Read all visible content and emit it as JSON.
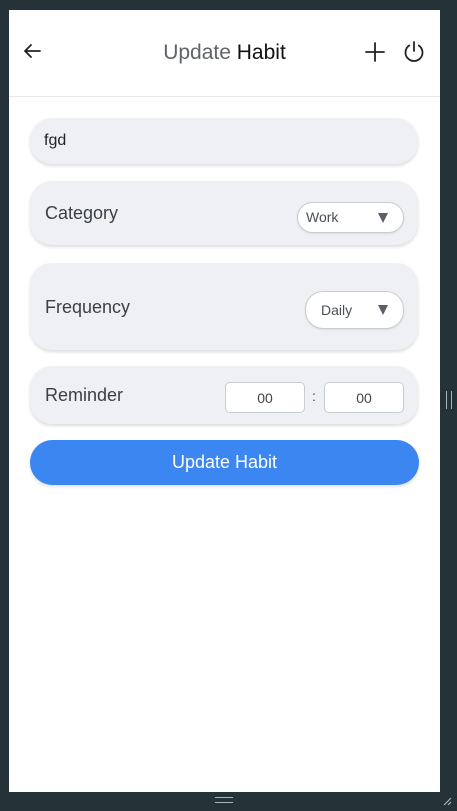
{
  "header": {
    "title_part1": "Update",
    "title_part2": "Habit",
    "back_icon": "arrow-left-icon",
    "add_icon": "plus-icon",
    "power_icon": "power-icon"
  },
  "form": {
    "habit_name": "fgd",
    "category": {
      "label": "Category",
      "selected": "Work"
    },
    "frequency": {
      "label": "Frequency",
      "selected": "Daily"
    },
    "reminder": {
      "label": "Reminder",
      "hours": "00",
      "separator": ":",
      "minutes": "00"
    },
    "submit_label": "Update Habit"
  },
  "colors": {
    "accent": "#3b86f0",
    "card_background": "#eff0f4",
    "window_frame": "#253338"
  }
}
